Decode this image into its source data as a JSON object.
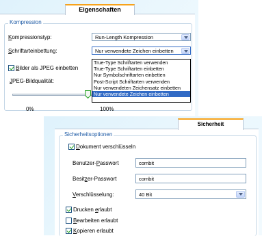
{
  "panel1": {
    "tab": "Eigenschaften",
    "group_title": "Kompression",
    "compression_label_u": "K",
    "compression_label_rest": "ompressionstyp:",
    "compression_value": "Run-Length Kompression",
    "font_label_u": "S",
    "font_label_rest": "chriftarteinbettung:",
    "font_value": "Nur verwendete Zeichen einbetten",
    "jpeg_checkbox_u": "B",
    "jpeg_checkbox_rest": "ilder als JPEG einbetten",
    "jpeg_checked": true,
    "jpeg_quality_u": "J",
    "jpeg_quality_rest": "PEG-Bildqualität:",
    "slider_min": "0%",
    "slider_max": "100%",
    "dropdown_options": [
      "True-Type Schriftarten verwenden",
      "True-Type Schriftarten einbetten",
      "Nur Symbolschriftarten einbetten",
      "Post-Script Schriftarten verwenden",
      "Nur verwendeten Zeichensatz einbetten",
      "Nur verwendete Zeichen einbetten"
    ],
    "selected_option_index": 5
  },
  "panel2": {
    "tab": "Sicherheit",
    "group_title": "Sicherheitsoptionen",
    "encrypt_u": "D",
    "encrypt_rest": "okument verschlüsseln",
    "encrypt_checked": true,
    "user_pw_pre": "Benutzer-",
    "user_pw_u": "P",
    "user_pw_post": "asswort",
    "user_pw_value": "combit",
    "owner_pw_pre": "Besit",
    "owner_pw_u": "z",
    "owner_pw_post": "er-Passwort",
    "owner_pw_value": "combit",
    "encryption_u": "V",
    "encryption_rest": "erschlüsselung:",
    "encryption_value": "40 Bit",
    "print_pre": "Drucken ",
    "print_u": "e",
    "print_post": "rlaubt",
    "print_checked": true,
    "edit_u": "B",
    "edit_rest": "earbeiten erlaubt",
    "edit_checked": false,
    "copy_u": "K",
    "copy_rest": "opieren erlaubt",
    "copy_checked": true
  },
  "colors": {
    "accent_tab": "#f7a31c",
    "group_title": "#1d5aa5",
    "selection": "#316ac5",
    "check": "#21a121"
  }
}
